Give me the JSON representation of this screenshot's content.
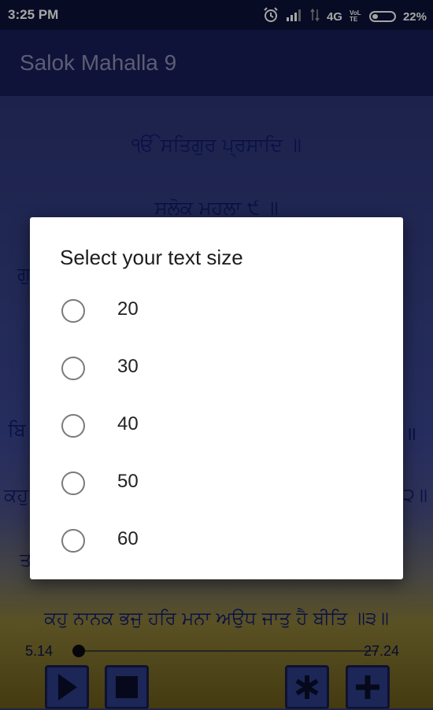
{
  "status_bar": {
    "time": "3:25 PM",
    "network": "4G",
    "volte": "VoLTE",
    "battery": "22%"
  },
  "toolbar": {
    "title": "Salok Mahalla 9"
  },
  "verses": [
    "ੴ ਸਤਿਗੁਰ ਪ੍ਰਸਾਦਿ ॥",
    "ਸਲੋਕ ਮਹਲਾ ੯ ॥",
    "ਕਹੁ ਨਾਨਕ ਭਜੁ ਹਰਿ ਮਨਾ ਅਉਧ ਜਾਤੁ ਹੈ ਬੀਤਿ ॥੩॥"
  ],
  "partial_verse_fragments": {
    "left": [
      "ਗੁ",
      "ਬਿ",
      "ਕਹੁ",
      "ਤ"
    ],
    "right": [
      "॥",
      "੨॥"
    ]
  },
  "player": {
    "elapsed": "5.14",
    "total": "27.24",
    "progress": 0.0,
    "buttons": [
      "play",
      "stop",
      "bookmark",
      "zoom"
    ]
  },
  "dialog": {
    "title": "Select your text size",
    "options": [
      "20",
      "30",
      "40",
      "50",
      "60"
    ]
  }
}
